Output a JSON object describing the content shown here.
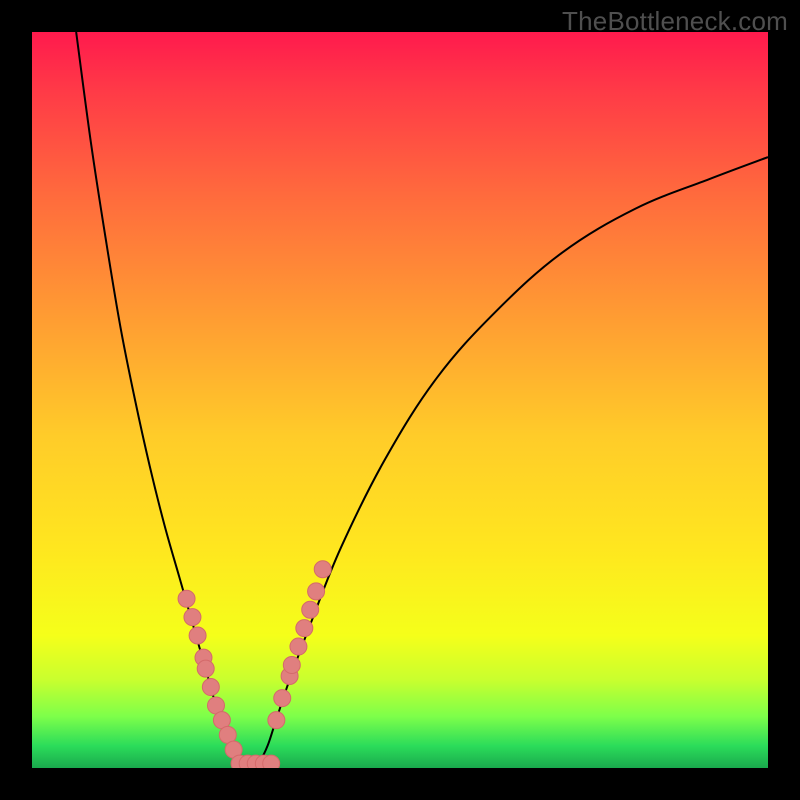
{
  "watermark": {
    "text": "TheBottleneck.com"
  },
  "colors": {
    "frame": "#000000",
    "curve": "#000000",
    "dot_fill": "#e07f7f",
    "dot_stroke": "#d46a6a",
    "gradient_stops": [
      "#ff1a4d",
      "#ff3a47",
      "#ff6a3d",
      "#ff9a33",
      "#ffcc29",
      "#ffe61f",
      "#f5ff1a",
      "#c9ff2e",
      "#7dff4a",
      "#2bdc5a",
      "#1aa94d"
    ]
  },
  "chart_data": {
    "type": "line",
    "title": "",
    "xlabel": "",
    "ylabel": "",
    "xlim": [
      0,
      100
    ],
    "ylim": [
      0,
      100
    ],
    "grid": false,
    "legend": false,
    "series": [
      {
        "name": "bottleneck-curve-left",
        "x": [
          6,
          8,
          10,
          12,
          14,
          16,
          18,
          20,
          22,
          24,
          25,
          26,
          27,
          28,
          29,
          30
        ],
        "y": [
          100,
          85,
          72,
          60,
          50,
          41,
          33,
          26,
          19,
          12,
          8.5,
          5.5,
          3.2,
          1.6,
          0.5,
          0
        ]
      },
      {
        "name": "bottleneck-curve-right",
        "x": [
          30,
          31,
          32,
          33,
          35,
          38,
          42,
          48,
          55,
          63,
          72,
          82,
          92,
          100
        ],
        "y": [
          0,
          1.0,
          3.0,
          6.0,
          12,
          20,
          30,
          42,
          53,
          62,
          70,
          76,
          80,
          83
        ]
      }
    ],
    "flat_segment": {
      "x0": 27.5,
      "x1": 33,
      "y": 0.5
    },
    "dots_left": [
      {
        "x": 21.0,
        "y": 23.0
      },
      {
        "x": 21.8,
        "y": 20.5
      },
      {
        "x": 22.5,
        "y": 18.0
      },
      {
        "x": 23.3,
        "y": 15.0
      },
      {
        "x": 23.6,
        "y": 13.5
      },
      {
        "x": 24.3,
        "y": 11.0
      },
      {
        "x": 25.0,
        "y": 8.5
      },
      {
        "x": 25.8,
        "y": 6.5
      },
      {
        "x": 26.6,
        "y": 4.5
      },
      {
        "x": 27.4,
        "y": 2.5
      }
    ],
    "dots_right": [
      {
        "x": 33.2,
        "y": 6.5
      },
      {
        "x": 34.0,
        "y": 9.5
      },
      {
        "x": 35.0,
        "y": 12.5
      },
      {
        "x": 35.3,
        "y": 14.0
      },
      {
        "x": 36.2,
        "y": 16.5
      },
      {
        "x": 37.0,
        "y": 19.0
      },
      {
        "x": 37.8,
        "y": 21.5
      },
      {
        "x": 38.6,
        "y": 24.0
      },
      {
        "x": 39.5,
        "y": 27.0
      }
    ],
    "dots_bottom": [
      {
        "x": 28.2,
        "y": 0.6
      },
      {
        "x": 29.3,
        "y": 0.6
      },
      {
        "x": 30.4,
        "y": 0.6
      },
      {
        "x": 31.5,
        "y": 0.6
      },
      {
        "x": 32.5,
        "y": 0.6
      }
    ]
  }
}
